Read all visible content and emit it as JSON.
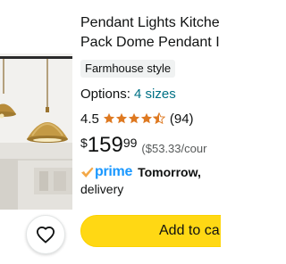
{
  "product": {
    "title_line_1": "Pendant Lights Kitche",
    "title_line_2": "Pack Dome Pendant I",
    "style_badge": "Farmhouse style",
    "options_label": "Options:",
    "options_link": "4 sizes",
    "rating_value": "4.5",
    "rating_stars": 4.5,
    "rating_count": "(94)",
    "price_symbol": "$",
    "price_whole": "159",
    "price_fraction": "99",
    "unit_price": "($53.33/cour",
    "prime_label": "prime",
    "delivery_day": "Tomorrow,",
    "delivery_label": "delivery",
    "add_to_cart_label": "Add to ca"
  },
  "icons": {
    "favorite": "heart-icon",
    "prime": "prime-check-icon",
    "star": "star-icon"
  },
  "colors": {
    "link": "#007185",
    "star": "#de7921",
    "prime": "#1a98ff",
    "button": "#ffd814",
    "badge_bg": "#f0f2f2"
  }
}
